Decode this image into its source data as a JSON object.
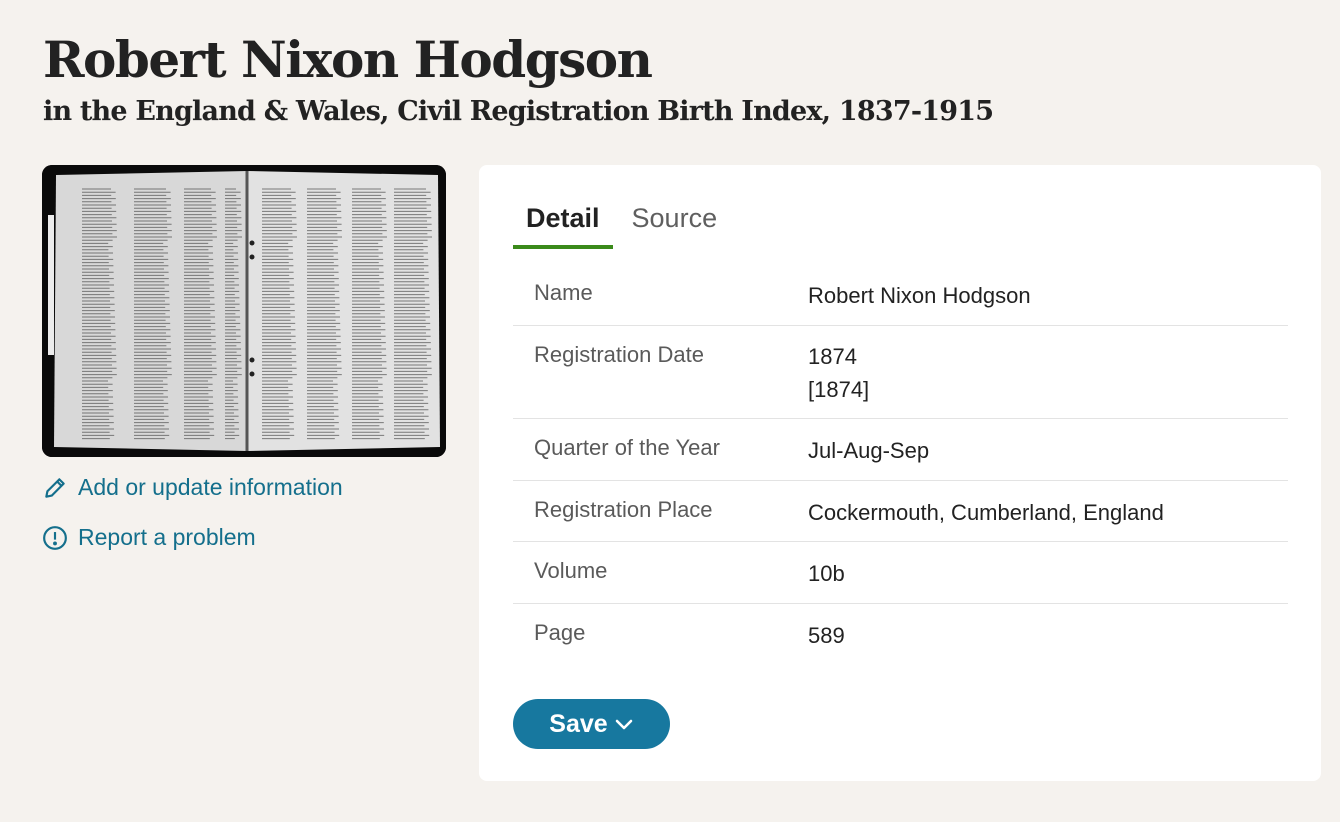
{
  "header": {
    "title": "Robert Nixon Hodgson",
    "subtitle": "in the England & Wales, Civil Registration Birth Index, 1837-1915"
  },
  "image": {
    "icon": "record-image-thumbnail"
  },
  "side_links": {
    "add_update": "Add or update information",
    "report": "Report a problem"
  },
  "tabs": [
    {
      "label": "Detail",
      "active": true
    },
    {
      "label": "Source",
      "active": false
    }
  ],
  "details": [
    {
      "label": "Name",
      "value": "Robert Nixon Hodgson"
    },
    {
      "label": "Registration Date",
      "value": "1874",
      "value2": "[1874]"
    },
    {
      "label": "Quarter of the Year",
      "value": "Jul-Aug-Sep"
    },
    {
      "label": "Registration Place",
      "value": "Cockermouth, Cumberland, England"
    },
    {
      "label": "Volume",
      "value": "10b"
    },
    {
      "label": "Page",
      "value": "589"
    }
  ],
  "save_button": {
    "label": "Save"
  },
  "colors": {
    "accent": "#17789f",
    "link": "#146f8c",
    "tab_underline": "#3a8a1a",
    "background": "#f5f2ee"
  }
}
